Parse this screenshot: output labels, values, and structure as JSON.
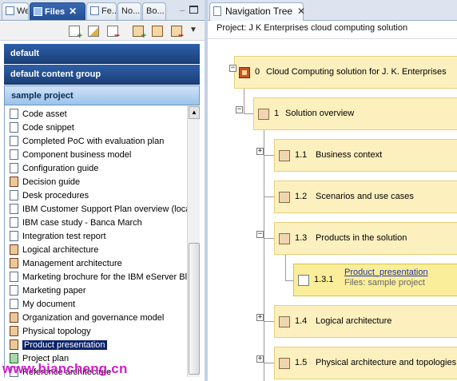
{
  "left_tabs": [
    {
      "label": "We..."
    },
    {
      "label": "Files",
      "active": true
    },
    {
      "label": "Fe..."
    },
    {
      "label": "No..."
    },
    {
      "label": "Bo..."
    }
  ],
  "left_toolbar": {
    "icons": [
      "add-document-icon",
      "edit-document-icon",
      "remove-document-icon",
      "add-template-icon",
      "edit-template-icon",
      "remove-template-icon"
    ],
    "menu_icon": "▼"
  },
  "groups": [
    "default",
    "default content group",
    "sample project"
  ],
  "files": [
    {
      "label": "Code asset",
      "icon": "doc"
    },
    {
      "label": "Code snippet",
      "icon": "doc"
    },
    {
      "label": "Completed PoC with evaluation plan",
      "icon": "doc"
    },
    {
      "label": "Component business model",
      "icon": "doc"
    },
    {
      "label": "Configuration guide",
      "icon": "doc"
    },
    {
      "label": "Decision guide",
      "icon": "template"
    },
    {
      "label": "Desk procedures",
      "icon": "doc"
    },
    {
      "label": "IBM Customer Support Plan overview (loca",
      "icon": "doc"
    },
    {
      "label": "IBM case study - Banca March",
      "icon": "doc"
    },
    {
      "label": "Integration test report",
      "icon": "doc"
    },
    {
      "label": "Logical architecture",
      "icon": "template"
    },
    {
      "label": "Management architecture",
      "icon": "template"
    },
    {
      "label": "Marketing brochure for the IBM eServer Bla",
      "icon": "doc"
    },
    {
      "label": "Marketing paper",
      "icon": "doc"
    },
    {
      "label": "My document",
      "icon": "doc"
    },
    {
      "label": "Organization and governance model",
      "icon": "template"
    },
    {
      "label": "Physical topology",
      "icon": "template"
    },
    {
      "label": "Product presentation",
      "icon": "template",
      "selected": true
    },
    {
      "label": "Project plan",
      "icon": "spreadsheet"
    },
    {
      "label": "Reference architecture",
      "icon": "doc"
    }
  ],
  "watermark": "www.biancheng.cn",
  "nav": {
    "tab_label": "Navigation Tree",
    "close_glyph": "✕",
    "project_label": "Project: J K Enterprises cloud computing solution",
    "nodes": [
      {
        "num": "0",
        "title": "Cloud Computing solution for J. K. Enterprises",
        "toggle": "−"
      },
      {
        "num": "1",
        "title": "Solution overview",
        "toggle": "−"
      },
      {
        "num": "1.1",
        "title": "Business context",
        "toggle": "+"
      },
      {
        "num": "1.2",
        "title": "Scenarios and use cases",
        "toggle": ""
      },
      {
        "num": "1.3",
        "title": "Products in the solution",
        "toggle": "−"
      },
      {
        "num": "1.3.1",
        "title": "Product_presentation",
        "sub": "Files: sample project",
        "toggle": ""
      },
      {
        "num": "1.4",
        "title": "Logical architecture",
        "toggle": "+"
      },
      {
        "num": "1.5",
        "title": "Physical architecture and topologies",
        "toggle": "+"
      }
    ]
  }
}
